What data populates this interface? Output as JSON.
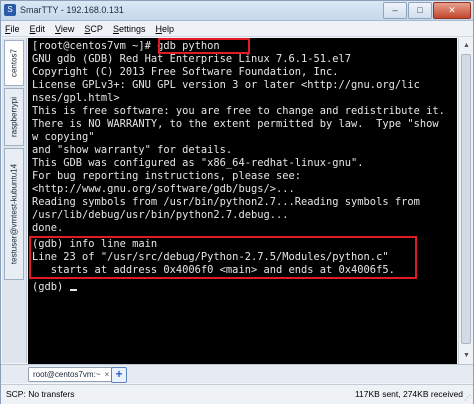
{
  "window": {
    "title": "SmarTTY - 192.168.0.131",
    "minimize_glyph": "–",
    "maximize_glyph": "□",
    "close_glyph": "✕"
  },
  "menu": {
    "items": [
      {
        "u": "F",
        "rest": "ile"
      },
      {
        "u": "E",
        "rest": "dit"
      },
      {
        "u": "V",
        "rest": "iew"
      },
      {
        "u": "S",
        "rest": "CP"
      },
      {
        "u": "S",
        "rest": "ettings"
      },
      {
        "u": "H",
        "rest": "elp"
      }
    ]
  },
  "side_tabs": [
    {
      "label": "centos7"
    },
    {
      "label": "raspberrypi"
    },
    {
      "label": "testuser@vmtest-kubuntu14"
    }
  ],
  "terminal": {
    "lines": [
      "[root@centos7vm ~]# gdb python",
      "GNU gdb (GDB) Red Hat Enterprise Linux 7.6.1-51.el7",
      "Copyright (C) 2013 Free Software Foundation, Inc.",
      "License GPLv3+: GNU GPL version 3 or later <http://gnu.org/lic",
      "nses/gpl.html>",
      "This is free software: you are free to change and redistribute it.",
      "There is NO WARRANTY, to the extent permitted by law.  Type \"show",
      "w copying\"",
      "and \"show warranty\" for details.",
      "This GDB was configured as \"x86_64-redhat-linux-gnu\".",
      "For bug reporting instructions, please see:",
      "<http://www.gnu.org/software/gdb/bugs/>...",
      "Reading symbols from /usr/bin/python2.7...Reading symbols from",
      "/usr/lib/debug/usr/bin/python2.7.debug...",
      "done.",
      "(gdb) info line main",
      "Line 23 of \"/usr/src/debug/Python-2.7.5/Modules/python.c\"",
      "   starts at address 0x4006f0 <main> and ends at 0x4006f5.",
      "(gdb) "
    ]
  },
  "session_tab": {
    "label": "root@centos7vm:~",
    "close_glyph": "×"
  },
  "new_tab_glyph": "+",
  "status": {
    "left": "SCP: No transfers",
    "right": "117KB sent, 274KB received"
  },
  "colors": {
    "terminal_bg": "#000000",
    "terminal_fg": "#e6e6e6",
    "highlight": "#e01b24"
  }
}
